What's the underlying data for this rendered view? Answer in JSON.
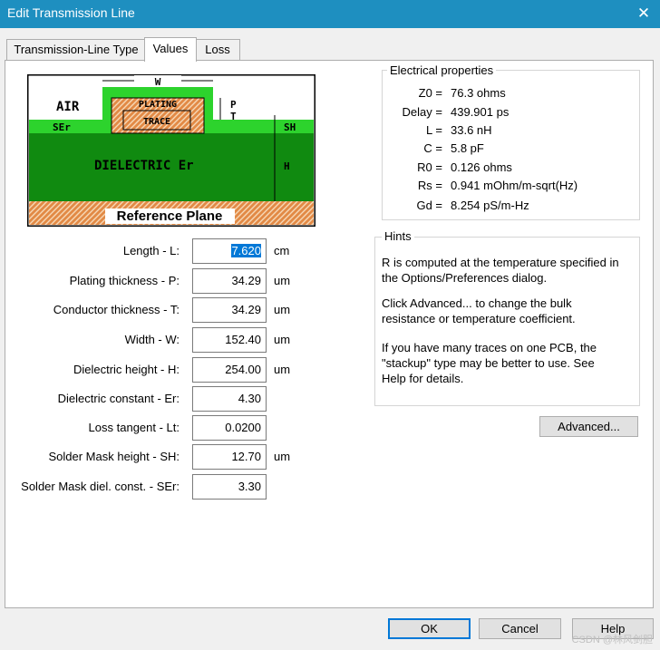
{
  "window": {
    "title": "Edit Transmission Line",
    "close_glyph": "✕"
  },
  "tabs": [
    {
      "label": "Transmission-Line Type"
    },
    {
      "label": "Values"
    },
    {
      "label": "Loss"
    }
  ],
  "diagram": {
    "air": "AIR",
    "ser": "SEr",
    "w": "W",
    "plating": "PLATING",
    "trace": "TRACE",
    "p": "P",
    "t": "T",
    "sh": "SH",
    "dielectric": "DIELECTRIC  Er",
    "h": "H",
    "reference": "Reference Plane",
    "colors": {
      "mask": "#2dd32d",
      "dielectric": "#108a10",
      "copper": "#e28a46",
      "trace": "#c07040"
    }
  },
  "fields": [
    {
      "label": "Length - L:",
      "value": "7.620",
      "unit": "cm",
      "selected": true
    },
    {
      "label": "Plating thickness - P:",
      "value": "34.29",
      "unit": "um"
    },
    {
      "label": "Conductor thickness - T:",
      "value": "34.29",
      "unit": "um"
    },
    {
      "label": "Width - W:",
      "value": "152.40",
      "unit": "um"
    },
    {
      "label": "Dielectric height - H:",
      "value": "254.00",
      "unit": "um"
    },
    {
      "label": "Dielectric constant - Er:",
      "value": "4.30",
      "unit": ""
    },
    {
      "label": "Loss tangent - Lt:",
      "value": "0.0200",
      "unit": ""
    },
    {
      "label": "Solder Mask height - SH:",
      "value": "12.70",
      "unit": "um"
    },
    {
      "label": "Solder Mask diel. const. - SEr:",
      "value": "3.30",
      "unit": ""
    }
  ],
  "electrical": {
    "title": "Electrical properties",
    "rows": [
      {
        "key": "Z0 =",
        "value": "76.3 ohms"
      },
      {
        "key": "Delay =",
        "value": "439.901 ps"
      },
      {
        "key": "L =",
        "value": "33.6 nH"
      },
      {
        "key": "C =",
        "value": "5.8 pF"
      },
      {
        "key": "R0 =",
        "value": "0.126 ohms"
      },
      {
        "key": "Rs =",
        "value": "0.941 mOhm/m-sqrt(Hz)"
      },
      {
        "key": "Gd =",
        "value": "8.254 pS/m-Hz"
      }
    ]
  },
  "hints": {
    "title": "Hints",
    "lines": [
      "R is computed at the temperature specified in",
      "the Options/Preferences dialog.",
      "Click Advanced... to change the bulk",
      "resistance or temperature coefficient.",
      "If you have many traces on one PCB, the",
      "\"stackup\" type may be better to use.  See",
      "Help for details."
    ]
  },
  "buttons": {
    "advanced": "Advanced...",
    "ok": "OK",
    "cancel": "Cancel",
    "help": "Help"
  },
  "watermark": "CSDN @林风剑胆"
}
